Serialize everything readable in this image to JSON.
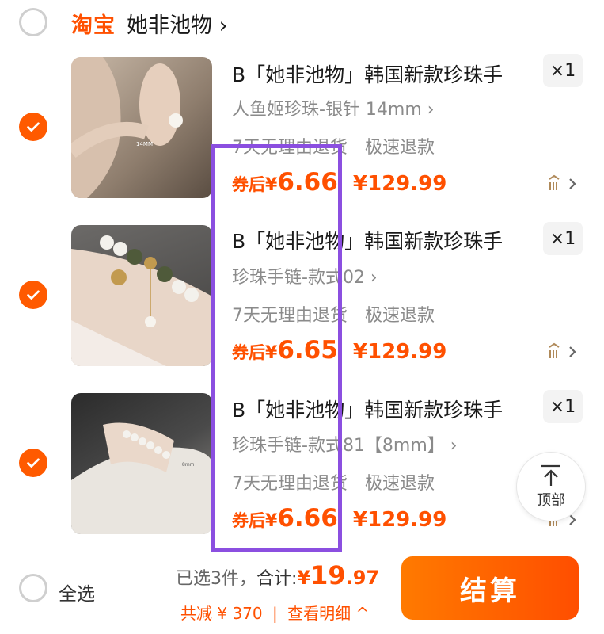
{
  "shop": {
    "platform": "淘宝",
    "name": "她非池物",
    "chevron": "›"
  },
  "items": [
    {
      "title": "B「她非池物」韩国新款珍珠手",
      "variant": "人鱼姬珍珠-银针 14mm ›",
      "services": [
        "7天无理由退货",
        "极速退款"
      ],
      "price_prefix": "券后",
      "price_symbol": "¥",
      "price_after": "6.66",
      "price_orig": "¥129.99",
      "qty": "×1",
      "image_text": "14MM"
    },
    {
      "title": "B「她非池物」韩国新款珍珠手",
      "variant": "珍珠手链-款式02 ›",
      "services": [
        "7天无理由退货",
        "极速退款"
      ],
      "price_prefix": "券后",
      "price_symbol": "¥",
      "price_after": "6.65",
      "price_orig": "¥129.99",
      "qty": "×1",
      "image_text": ""
    },
    {
      "title": "B「她非池物」韩国新款珍珠手",
      "variant": "珍珠手链-款式81【8mm】 ›",
      "services": [
        "7天无理由退货",
        "极速退款"
      ],
      "price_prefix": "券后",
      "price_symbol": "¥",
      "price_after": "6.66",
      "price_orig": "¥129.99",
      "qty": "×1",
      "image_text": "8mm"
    }
  ],
  "top_button": {
    "label": "顶部"
  },
  "footer": {
    "select_all": "全选",
    "selected": "已选3件，",
    "total_label": "合计:",
    "total_symbol": "¥",
    "total_int": "19",
    "total_dec": ".97",
    "discount": "共减 ¥ 370",
    "details": "查看明细 ^",
    "checkout": "结算"
  },
  "colors": {
    "accent": "#ff5000",
    "highlight": "#8b4fe0"
  }
}
